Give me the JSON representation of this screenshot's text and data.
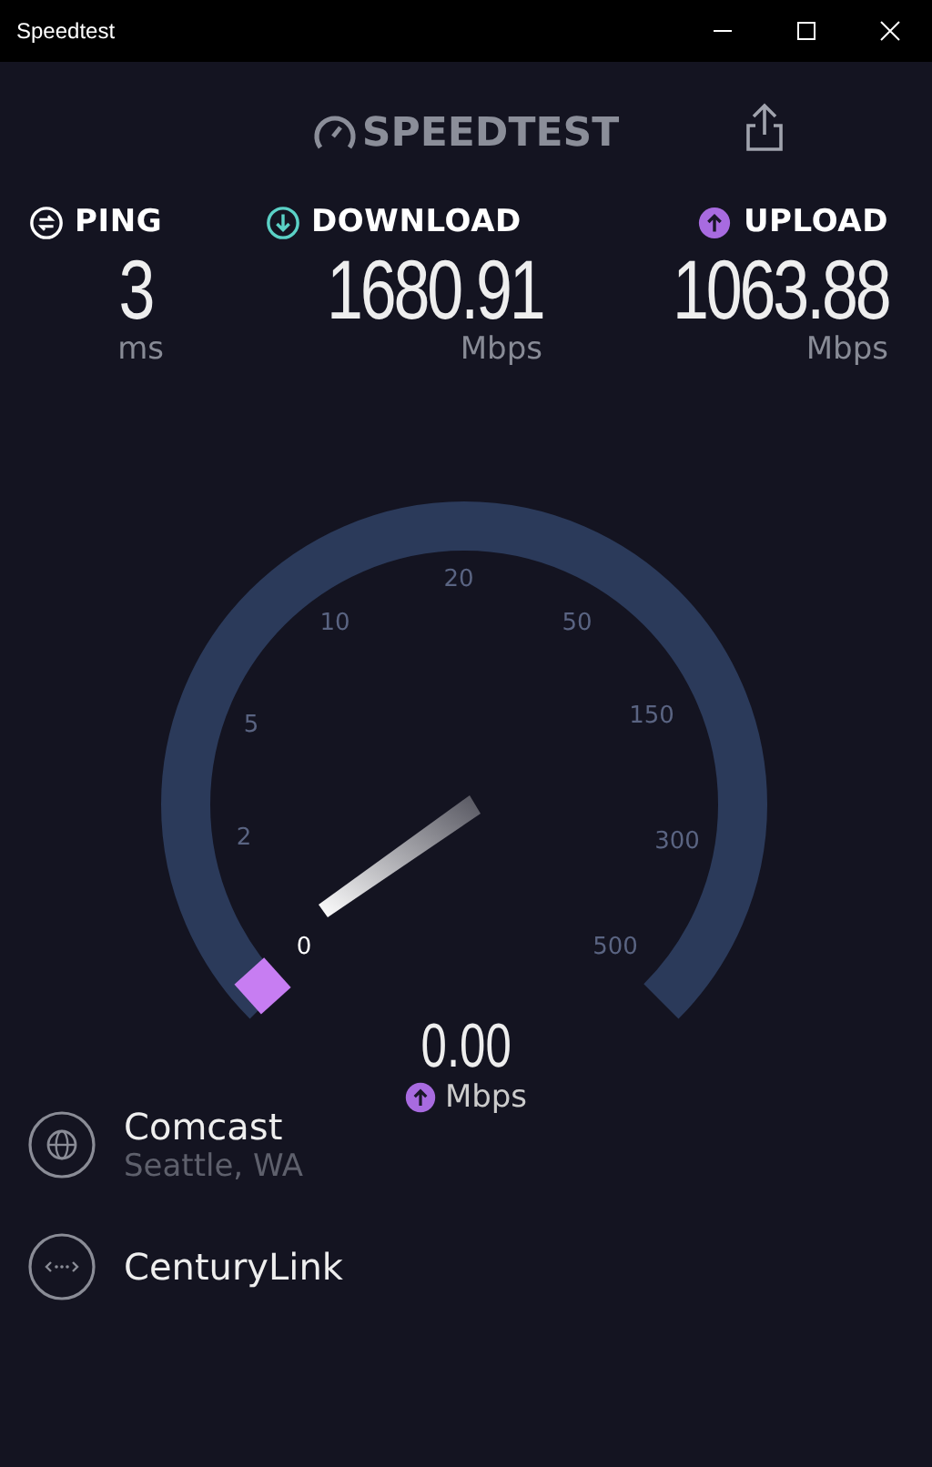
{
  "window": {
    "title": "Speedtest"
  },
  "logo": {
    "text": "SPEEDTEST"
  },
  "metrics": [
    {
      "kind": "ping",
      "label": "PING",
      "value": "3",
      "unit": "ms"
    },
    {
      "kind": "download",
      "label": "DOWNLOAD",
      "value": "1680.91",
      "unit": "Mbps"
    },
    {
      "kind": "upload",
      "label": "UPLOAD",
      "value": "1063.88",
      "unit": "Mbps"
    }
  ],
  "gauge": {
    "ticks": [
      "0",
      "2",
      "5",
      "10",
      "20",
      "50",
      "150",
      "300",
      "500"
    ],
    "reading": "0.00",
    "unit": "Mbps"
  },
  "servers": [
    {
      "kind": "isp",
      "name": "Comcast",
      "location": "Seattle, WA"
    },
    {
      "kind": "host",
      "name": "CenturyLink"
    }
  ]
}
